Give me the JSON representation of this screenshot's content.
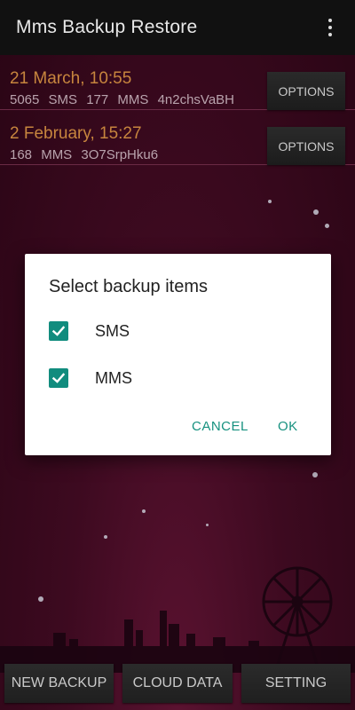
{
  "app": {
    "title": "Mms Backup Restore"
  },
  "backups": [
    {
      "date": "21 March, 10:55",
      "meta": "5065 SMS  177 MMS  4n2chsVaBH",
      "options_label": "OPTIONS"
    },
    {
      "date": "2 February, 15:27",
      "meta": "168 MMS  3O7SrpHku6",
      "options_label": "OPTIONS"
    }
  ],
  "dialog": {
    "title": "Select backup items",
    "items": [
      {
        "label": "SMS",
        "checked": true
      },
      {
        "label": "MMS",
        "checked": true
      }
    ],
    "cancel_label": "CANCEL",
    "ok_label": "OK"
  },
  "bottom": {
    "new_backup_label": "NEW BACKUP",
    "cloud_data_label": "CLOUD DATA",
    "setting_label": "SETTING"
  },
  "colors": {
    "accent": "#118c7e",
    "date_text": "#c7853e",
    "background": "#3d0a20"
  },
  "icons": {
    "menu": "overflow-menu-icon",
    "checkbox": "check-icon"
  }
}
